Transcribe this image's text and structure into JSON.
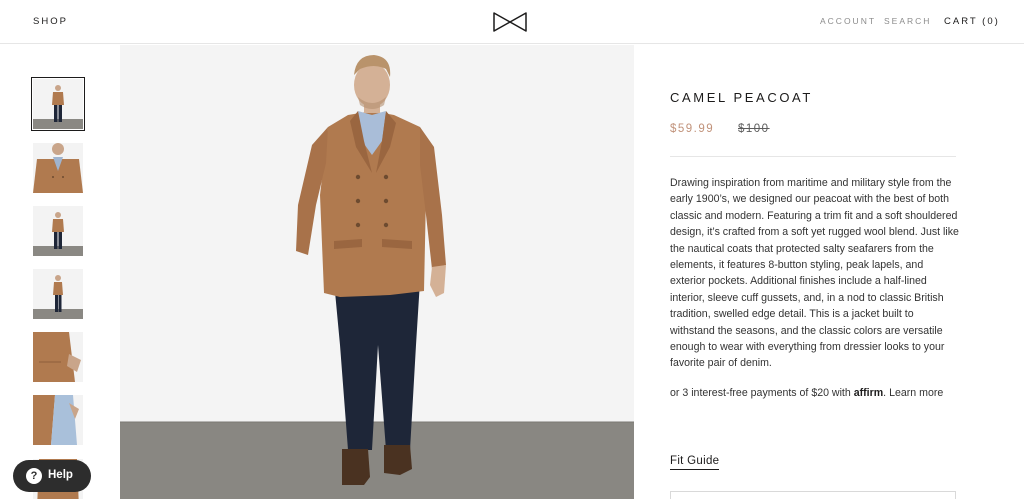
{
  "header": {
    "shop_label": "SHOP",
    "account_label": "ACCOUNT",
    "search_label": "SEARCH",
    "cart_label": "CART (0)",
    "logo_icon": "bowtie-logo-icon"
  },
  "gallery": {
    "thumbnails": [
      "full-body-front",
      "coat-closeup",
      "full-body-front-2",
      "full-body-side",
      "pocket-detail",
      "lining-detail"
    ],
    "selected_index": 0
  },
  "product": {
    "title": "CAMEL PEACOAT",
    "price": "$59.99",
    "compare_price": "$100",
    "description": "Drawing inspiration from maritime and military style from the early 1900’s, we designed our peacoat with the best of both classic and modern. Featuring a trim fit and a soft shouldered design, it’s crafted from a soft yet rugged wool blend. Just like the nautical coats that protected salty seafarers from the elements, it features 8-button styling, peak lapels, and exterior pockets. Additional finishes include a half-lined interior, sleeve cuff gussets, and, in a nod to classic British tradition, swelled edge detail. This is a jacket built to withstand the seasons, and the classic colors are versatile enough to wear with everything from dressier looks to your favorite pair of denim.",
    "affirm_prefix": "or 3 interest-free payments of $20 with",
    "affirm_brand": "affirm",
    "affirm_suffix": ".",
    "learn_more": "Learn more",
    "fit_guide": "Fit Guide"
  },
  "help": {
    "label": "Help",
    "icon_glyph": "?"
  },
  "colors": {
    "sale_price": "#c1927a",
    "coat": "#b07a4f",
    "trousers": "#1e2638",
    "help_bg": "#2d2d2d"
  }
}
